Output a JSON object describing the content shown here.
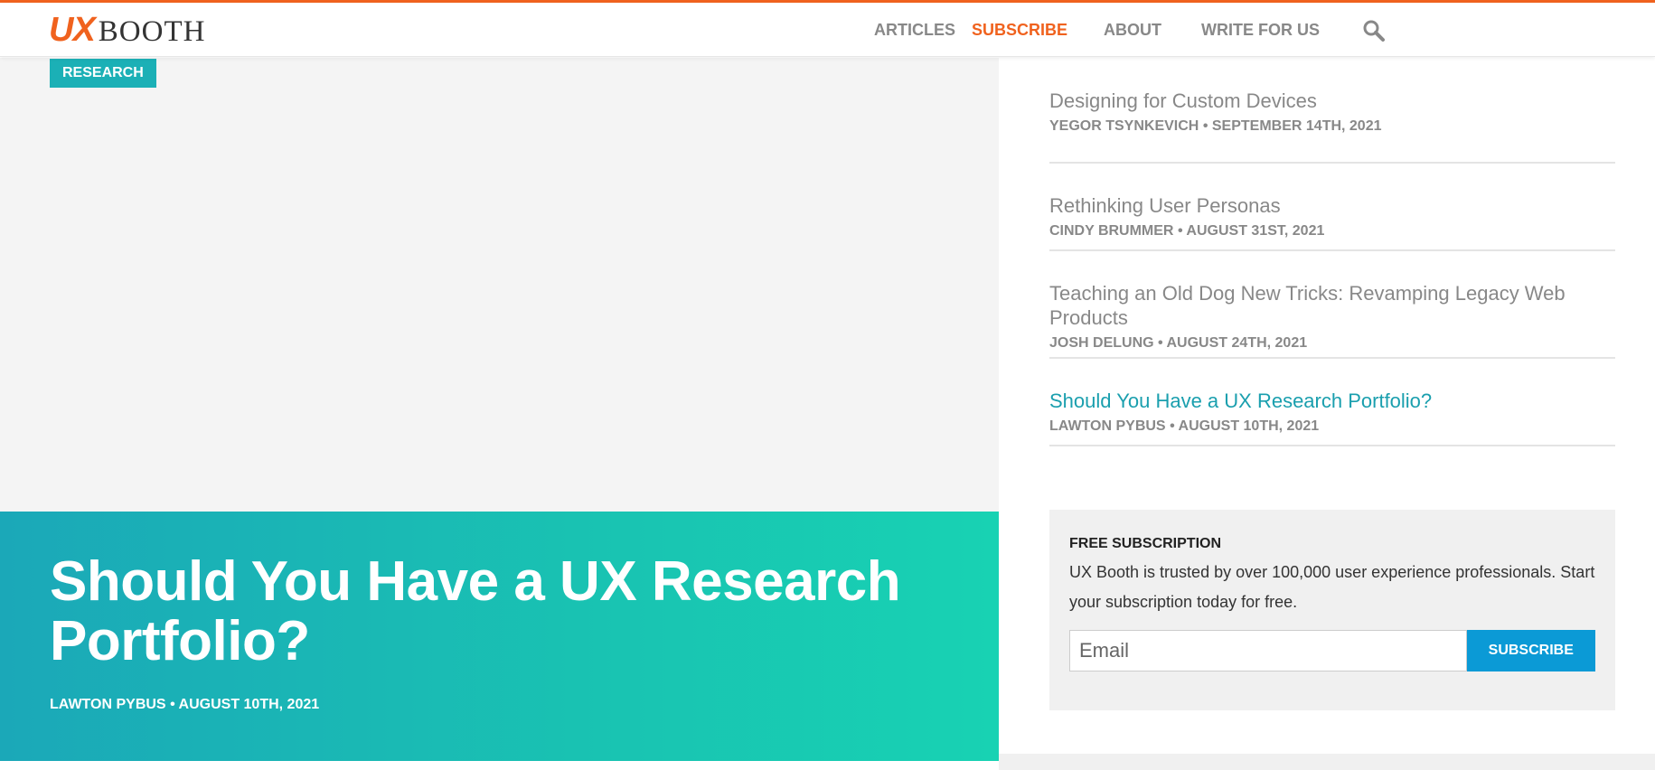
{
  "site": {
    "logo_ux": "UX",
    "logo_booth": "BOOTH",
    "brand_color": "#f0621e",
    "accent_teal": "#1bb0b6",
    "accent_blue": "#0b9ad6"
  },
  "nav": {
    "items": [
      {
        "label": "ARTICLES",
        "active": false
      },
      {
        "label": "SUBSCRIBE",
        "active": true
      },
      {
        "label": "ABOUT",
        "active": false
      },
      {
        "label": "WRITE FOR US",
        "active": false
      }
    ],
    "search_icon": "search-icon"
  },
  "hero": {
    "category": "RESEARCH",
    "title": "Should You Have a UX Research Portfolio?",
    "author": "LAWTON PYBUS",
    "separator": "•",
    "date": "AUGUST 10TH, 2021"
  },
  "sidebar": {
    "articles": [
      {
        "title": "Designing for Custom Devices",
        "author": "YEGOR TSYNKEVICH",
        "date": "SEPTEMBER 14TH, 2021",
        "current": false
      },
      {
        "title": "Rethinking User Personas",
        "author": "CINDY BRUMMER",
        "date": "AUGUST 31ST, 2021",
        "current": false
      },
      {
        "title": "Teaching an Old Dog New Tricks: Revamping Legacy Web Products",
        "author": "JOSH DELUNG",
        "date": "AUGUST 24TH, 2021",
        "current": false
      },
      {
        "title": "Should You Have a UX Research Portfolio?",
        "author": "LAWTON PYBUS",
        "date": "AUGUST 10TH, 2021",
        "current": true
      }
    ],
    "subscription": {
      "heading": "FREE SUBSCRIPTION",
      "text": "UX Booth is trusted by over 100,000 user experience professionals. Start your subscription today for free.",
      "email_placeholder": "Email",
      "email_value": "",
      "button_label": "SUBSCRIBE"
    }
  }
}
